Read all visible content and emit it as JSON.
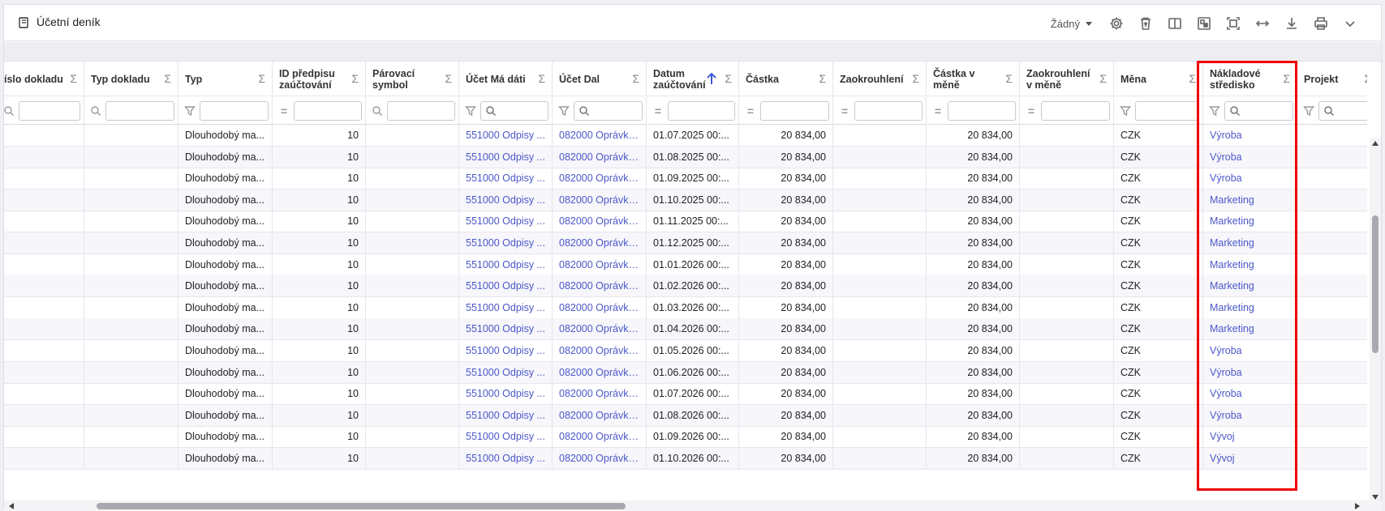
{
  "window": {
    "title": "Účetní deník"
  },
  "toolbar": {
    "layout_select": "Žádný",
    "icons": [
      "gear-icon",
      "delete-icon",
      "columns-icon",
      "image-icon",
      "fit-screen-icon",
      "expand-width-icon",
      "download-icon",
      "print-icon",
      "chevron-down-icon"
    ]
  },
  "columns": [
    {
      "key": "cislo",
      "label": "íslo dokladu"
    },
    {
      "key": "typdok",
      "label": "Typ dokladu"
    },
    {
      "key": "typ",
      "label": "Typ"
    },
    {
      "key": "idpred",
      "label": "ID předpisu zaúčtování"
    },
    {
      "key": "parsym",
      "label": "Párovací symbol"
    },
    {
      "key": "madati",
      "label": "Účet Má dáti"
    },
    {
      "key": "dal",
      "label": "Účet Dal"
    },
    {
      "key": "datum",
      "label": "Datum zaúčtování"
    },
    {
      "key": "castka",
      "label": "Částka"
    },
    {
      "key": "zaokr",
      "label": "Zaokrouhlení"
    },
    {
      "key": "castkamene",
      "label": "Částka v měně"
    },
    {
      "key": "zaokrmene",
      "label": "Zaokrouhlení v měně"
    },
    {
      "key": "mena",
      "label": "Měna"
    },
    {
      "key": "stredisko",
      "label": "Nákladové středisko"
    },
    {
      "key": "projekt",
      "label": "Projekt"
    }
  ],
  "sigma": "Σ",
  "filter_eq": "=",
  "rows": [
    {
      "typ": "Dlouhodobý ma...",
      "idpred": "10",
      "madati": "551000 Odpisy ...",
      "dal": "082000 Oprávky...",
      "datum": "01.07.2025 00:...",
      "castka": "20 834,00",
      "castkamene": "20 834,00",
      "mena": "CZK",
      "stredisko": "Výroba"
    },
    {
      "typ": "Dlouhodobý ma...",
      "idpred": "10",
      "madati": "551000 Odpisy ...",
      "dal": "082000 Oprávky...",
      "datum": "01.08.2025 00:...",
      "castka": "20 834,00",
      "castkamene": "20 834,00",
      "mena": "CZK",
      "stredisko": "Výroba"
    },
    {
      "typ": "Dlouhodobý ma...",
      "idpred": "10",
      "madati": "551000 Odpisy ...",
      "dal": "082000 Oprávky...",
      "datum": "01.09.2025 00:...",
      "castka": "20 834,00",
      "castkamene": "20 834,00",
      "mena": "CZK",
      "stredisko": "Výroba"
    },
    {
      "typ": "Dlouhodobý ma...",
      "idpred": "10",
      "madati": "551000 Odpisy ...",
      "dal": "082000 Oprávky...",
      "datum": "01.10.2025 00:...",
      "castka": "20 834,00",
      "castkamene": "20 834,00",
      "mena": "CZK",
      "stredisko": "Marketing"
    },
    {
      "typ": "Dlouhodobý ma...",
      "idpred": "10",
      "madati": "551000 Odpisy ...",
      "dal": "082000 Oprávky...",
      "datum": "01.11.2025 00:...",
      "castka": "20 834,00",
      "castkamene": "20 834,00",
      "mena": "CZK",
      "stredisko": "Marketing"
    },
    {
      "typ": "Dlouhodobý ma...",
      "idpred": "10",
      "madati": "551000 Odpisy ...",
      "dal": "082000 Oprávky...",
      "datum": "01.12.2025 00:...",
      "castka": "20 834,00",
      "castkamene": "20 834,00",
      "mena": "CZK",
      "stredisko": "Marketing"
    },
    {
      "typ": "Dlouhodobý ma...",
      "idpred": "10",
      "madati": "551000 Odpisy ...",
      "dal": "082000 Oprávky...",
      "datum": "01.01.2026 00:...",
      "castka": "20 834,00",
      "castkamene": "20 834,00",
      "mena": "CZK",
      "stredisko": "Marketing"
    },
    {
      "typ": "Dlouhodobý ma...",
      "idpred": "10",
      "madati": "551000 Odpisy ...",
      "dal": "082000 Oprávky...",
      "datum": "01.02.2026 00:...",
      "castka": "20 834,00",
      "castkamene": "20 834,00",
      "mena": "CZK",
      "stredisko": "Marketing"
    },
    {
      "typ": "Dlouhodobý ma...",
      "idpred": "10",
      "madati": "551000 Odpisy ...",
      "dal": "082000 Oprávky...",
      "datum": "01.03.2026 00:...",
      "castka": "20 834,00",
      "castkamene": "20 834,00",
      "mena": "CZK",
      "stredisko": "Marketing"
    },
    {
      "typ": "Dlouhodobý ma...",
      "idpred": "10",
      "madati": "551000 Odpisy ...",
      "dal": "082000 Oprávky...",
      "datum": "01.04.2026 00:...",
      "castka": "20 834,00",
      "castkamene": "20 834,00",
      "mena": "CZK",
      "stredisko": "Marketing"
    },
    {
      "typ": "Dlouhodobý ma...",
      "idpred": "10",
      "madati": "551000 Odpisy ...",
      "dal": "082000 Oprávky...",
      "datum": "01.05.2026 00:...",
      "castka": "20 834,00",
      "castkamene": "20 834,00",
      "mena": "CZK",
      "stredisko": "Výroba"
    },
    {
      "typ": "Dlouhodobý ma...",
      "idpred": "10",
      "madati": "551000 Odpisy ...",
      "dal": "082000 Oprávky...",
      "datum": "01.06.2026 00:...",
      "castka": "20 834,00",
      "castkamene": "20 834,00",
      "mena": "CZK",
      "stredisko": "Výroba"
    },
    {
      "typ": "Dlouhodobý ma...",
      "idpred": "10",
      "madati": "551000 Odpisy ...",
      "dal": "082000 Oprávky...",
      "datum": "01.07.2026 00:...",
      "castka": "20 834,00",
      "castkamene": "20 834,00",
      "mena": "CZK",
      "stredisko": "Výroba"
    },
    {
      "typ": "Dlouhodobý ma...",
      "idpred": "10",
      "madati": "551000 Odpisy ...",
      "dal": "082000 Oprávky...",
      "datum": "01.08.2026 00:...",
      "castka": "20 834,00",
      "castkamene": "20 834,00",
      "mena": "CZK",
      "stredisko": "Výroba"
    },
    {
      "typ": "Dlouhodobý ma...",
      "idpred": "10",
      "madati": "551000 Odpisy ...",
      "dal": "082000 Oprávky...",
      "datum": "01.09.2026 00:...",
      "castka": "20 834,00",
      "castkamene": "20 834,00",
      "mena": "CZK",
      "stredisko": "Vývoj"
    },
    {
      "typ": "Dlouhodobý ma...",
      "idpred": "10",
      "madati": "551000 Odpisy ...",
      "dal": "082000 Oprávky...",
      "datum": "01.10.2026 00:...",
      "castka": "20 834,00",
      "castkamene": "20 834,00",
      "mena": "CZK",
      "stredisko": "Vývoj"
    }
  ],
  "colors": {
    "link": "#4b58c8",
    "highlight": "#e00000",
    "alt_row": "#f6f6fb"
  }
}
